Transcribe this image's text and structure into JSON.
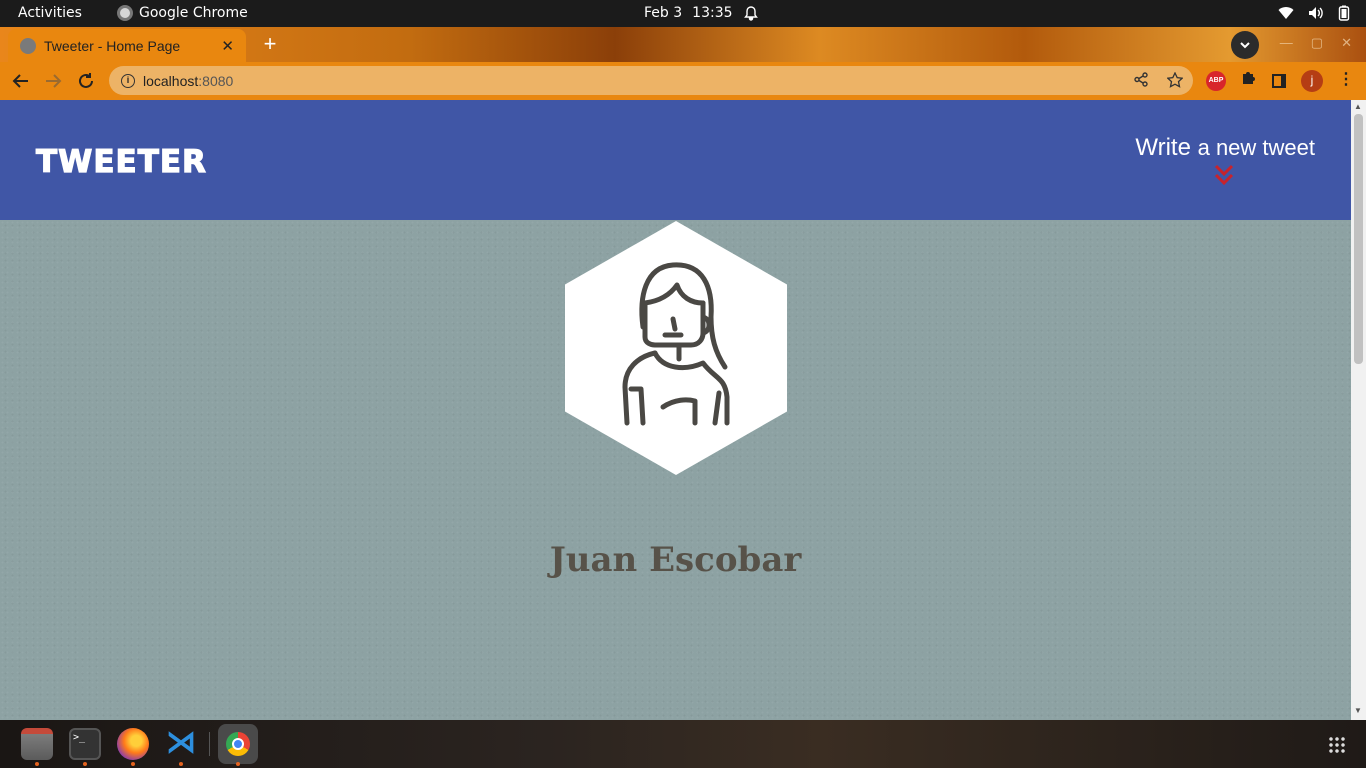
{
  "system": {
    "activities": "Activities",
    "app_name": "Google Chrome",
    "date": "Feb 3",
    "time": "13:35"
  },
  "browser": {
    "tab_title": "Tweeter - Home Page",
    "tab_close": "✕",
    "new_tab": "+",
    "url_host": "localhost",
    "url_port": ":8080",
    "avatar_initial": "j",
    "abp_label": "ABP"
  },
  "page": {
    "brand": "TWEETER",
    "compose_bold": "Write",
    "compose_rest": "a new tweet",
    "accent_color": "#c8232c",
    "nav_color": "#4056a6",
    "background_color": "#8da2a3"
  },
  "profile": {
    "name": "Juan Escobar",
    "avatar_icon": "woman-avatar-icon"
  },
  "dock": {
    "items": [
      "files-icon",
      "terminal-icon",
      "firefox-icon",
      "vscode-icon",
      "chrome-icon",
      "app-grid-icon"
    ]
  }
}
